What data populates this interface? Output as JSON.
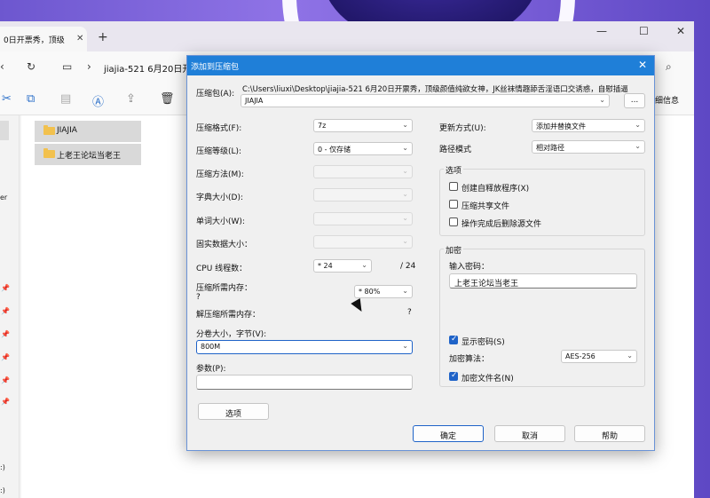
{
  "explorer": {
    "tab_title": "0日开票秀，顶级",
    "path": "jiajia-521 6月20日开",
    "toolbar_right": "细信息",
    "items": [
      {
        "label": "JIAJIA"
      },
      {
        "label": "上老王论坛当老王"
      }
    ],
    "side_labels": [
      "er",
      ":)",
      ":)"
    ]
  },
  "dialog": {
    "title": "添加到压缩包",
    "archive_label": "压缩包(A):",
    "archive_path": "C:\\Users\\liuxi\\Desktop\\jiajia-521 6月20日开票秀，顶级颜值纯欲女神，JK丝袜情趣舔舌淫语口交诱惑，自慰插逼",
    "archive_name": "JIAJIA",
    "browse_label": "...",
    "format_label": "压缩格式(F):",
    "format_value": "7z",
    "level_label": "压缩等级(L):",
    "level_value": "0 - 仅存储",
    "method_label": "压缩方法(M):",
    "dict_label": "字典大小(D):",
    "word_label": "单词大小(W):",
    "solid_label": "固实数据大小：",
    "cpu_label": "CPU 线程数：",
    "cpu_value": "* 24",
    "cpu_total": "/ 24",
    "mem_label": "压缩所需内存：",
    "mem_q": "?",
    "mem_value": "* 80%",
    "decomp_label": "解压缩所需内存：",
    "decomp_q": "?",
    "split_label": "分卷大小，字节(V):",
    "split_value": "800M",
    "params_label": "参数(P):",
    "params_value": "",
    "options_button": "选项",
    "update_label": "更新方式(U):",
    "update_value": "添加并替换文件",
    "pathmode_label": "路径模式",
    "pathmode_value": "相对路径",
    "options_group": "选项",
    "opt_sfx": "创建自释放程序(X)",
    "opt_shared": "压缩共享文件",
    "opt_delete": "操作完成后删除源文件",
    "encrypt_group": "加密",
    "password_label": "输入密码：",
    "password_value": "上老王论坛当老王",
    "show_password": "显示密码(S)",
    "algo_label": "加密算法：",
    "algo_value": "AES-256",
    "encrypt_names": "加密文件名(N)",
    "ok": "确定",
    "cancel": "取消",
    "help": "帮助"
  }
}
